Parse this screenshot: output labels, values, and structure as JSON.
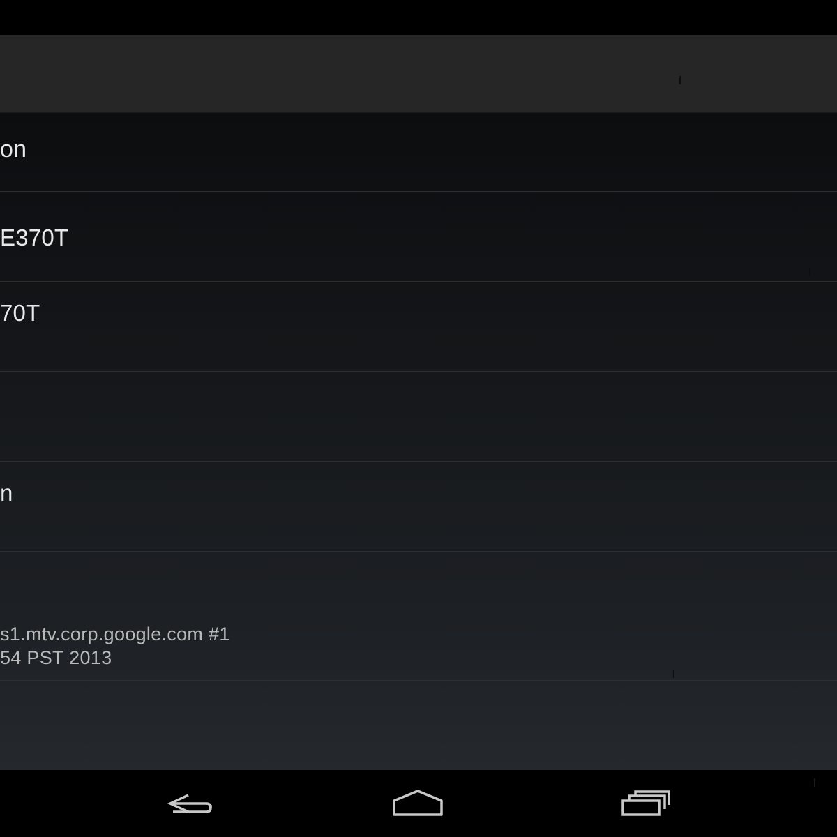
{
  "settings_list": {
    "rows": [
      {
        "title": "on"
      },
      {
        "title": "E370T"
      },
      {
        "title": "70T"
      },
      {
        "title": ""
      },
      {
        "title": "n"
      },
      {
        "title": "",
        "lines": [
          "s1.mtv.corp.google.com #1",
          "54 PST 2013"
        ]
      }
    ]
  },
  "nav_bar": {
    "back_icon": "back-arrow-icon",
    "home_icon": "home-icon",
    "recents_icon": "recent-apps-icon"
  },
  "colors": {
    "action_bar": "#262626",
    "background_top": "#0c0d0f",
    "background_bottom": "#25282d",
    "divider": "#2c2f33",
    "text_primary": "#e9e9e9",
    "text_secondary": "#b9b9b9",
    "nav_icon": "#c8c8c8"
  }
}
